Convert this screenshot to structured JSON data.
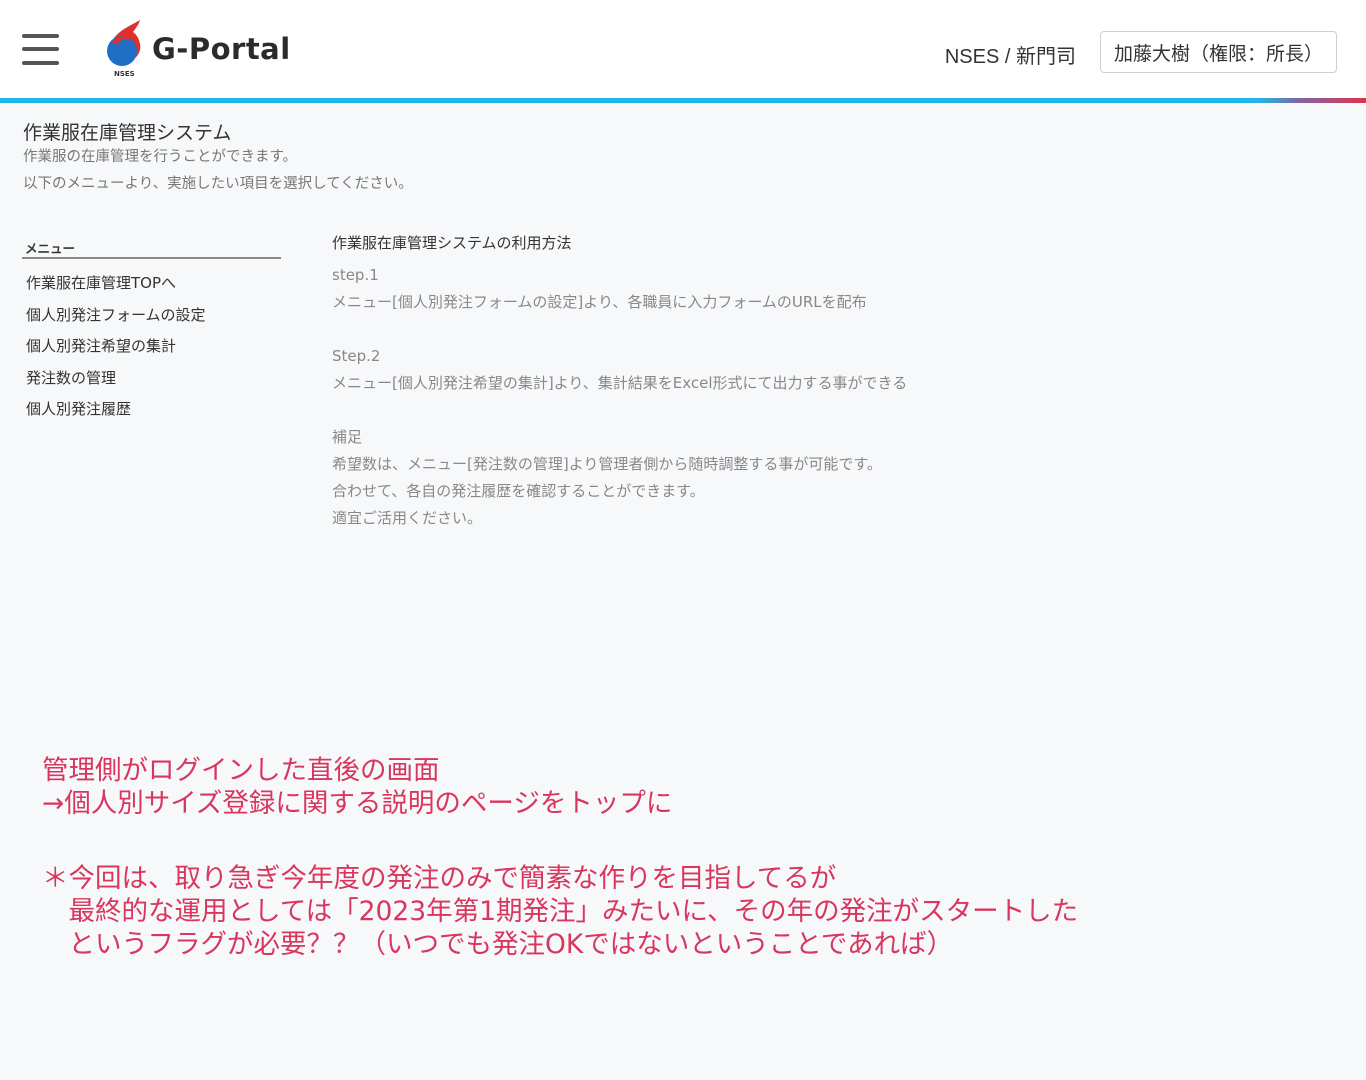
{
  "header": {
    "logo_text": "G-Portal",
    "logo_small": "NSES",
    "org": "NSES / 新門司",
    "user": "加藤大樹（権限：所長）",
    "accent_color": "#22b7e8"
  },
  "page": {
    "title": "作業服在庫管理システム",
    "desc1": "作業服の在庫管理を行うことができます。",
    "desc2": "以下のメニューより、実施したい項目を選択してください。"
  },
  "menu": {
    "heading": "メニュー",
    "items": [
      "作業服在庫管理TOPへ",
      "個人別発注フォームの設定",
      "個人別発注希望の集計",
      "発注数の管理",
      "個人別発注履歴"
    ]
  },
  "content": {
    "title": "作業服在庫管理システムの利用方法",
    "step1_label": "step.1",
    "step1_text": "メニュー[個人別発注フォームの設定]より、各職員に入力フォームのURLを配布",
    "step2_label": "Step.2",
    "step2_text": "メニュー[個人別発注希望の集計]より、集計結果をExcel形式にて出力する事ができる",
    "note_label": "補足",
    "note_line1": "希望数は、メニュー[発注数の管理]より管理者側から随時調整する事が可能です。",
    "note_line2": "合わせて、各自の発注履歴を確認することができます。",
    "note_line3": "適宜ご活用ください。"
  },
  "annotation": {
    "line1": "管理側がログインした直後の画面",
    "line2": "→個人別サイズ登録に関する説明のページをトップに",
    "line3": "＊今回は、取り急ぎ今年度の発注のみで簡素な作りを目指してるが",
    "line4": "　最終的な運用としては「2023年第1期発注」みたいに、その年の発注がスタートした",
    "line5": "　というフラグが必要？？（いつでも発注OKではないということであれば）",
    "color": "#d9365e"
  }
}
